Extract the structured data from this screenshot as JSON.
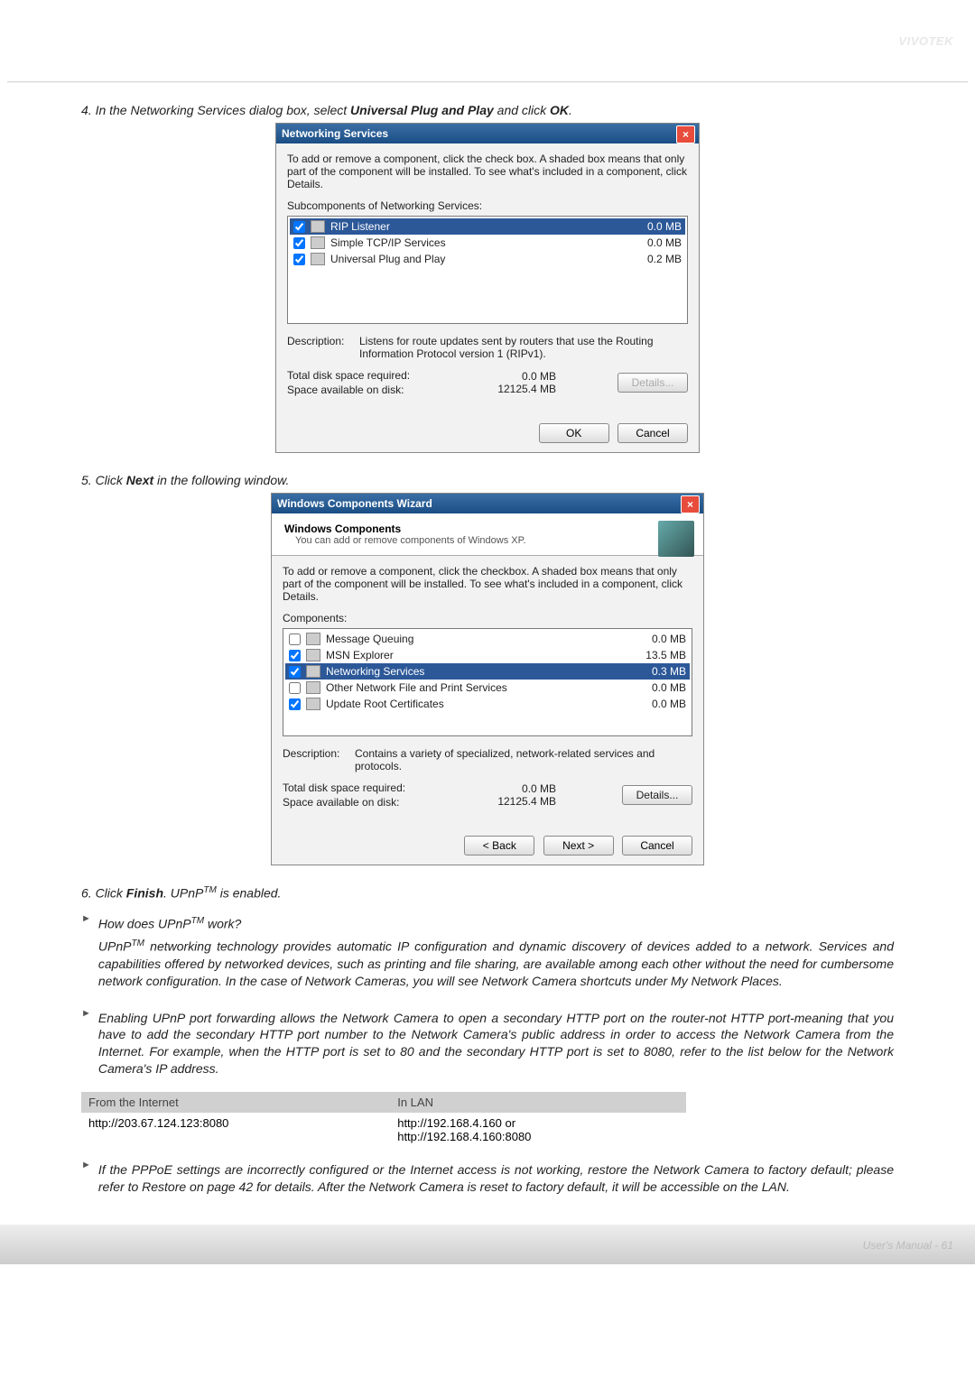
{
  "brand": "VIVOTEK",
  "step4_text_pre": "4. In the Networking Services dialog box, select ",
  "step4_bold1": "Universal Plug and Play",
  "step4_mid": " and click ",
  "step4_bold2": "OK",
  "step4_end": ".",
  "dlg1": {
    "title": "Networking Services",
    "intro": "To add or remove a component, click the check box. A shaded box means that only part of the component will be installed. To see what's included in a component, click Details.",
    "subcap": "Subcomponents of Networking Services:",
    "rows": [
      {
        "name": "RIP Listener",
        "size": "0.0 MB",
        "sel": true
      },
      {
        "name": "Simple TCP/IP Services",
        "size": "0.0 MB",
        "sel": false
      },
      {
        "name": "Universal Plug and Play",
        "size": "0.2 MB",
        "sel": false
      }
    ],
    "desc_lbl": "Description:",
    "desc": "Listens for route updates sent by routers that use the Routing Information Protocol version 1 (RIPv1).",
    "total_lbl": "Total disk space required:",
    "total": "0.0 MB",
    "avail_lbl": "Space available on disk:",
    "avail": "12125.4 MB",
    "details": "Details...",
    "ok": "OK",
    "cancel": "Cancel"
  },
  "step5_pre": "5. Click ",
  "step5_bold": "Next",
  "step5_post": " in the following window.",
  "dlg2": {
    "title": "Windows Components Wizard",
    "h1": "Windows Components",
    "h2": "You can add or remove components of Windows XP.",
    "intro": "To add or remove a component, click the checkbox.  A shaded box means that only part of the component will be installed.  To see what's included in a component, click Details.",
    "compcap": "Components:",
    "rows": [
      {
        "name": "Message Queuing",
        "size": "0.0 MB",
        "sel": false,
        "un": true
      },
      {
        "name": "MSN Explorer",
        "size": "13.5 MB",
        "sel": false
      },
      {
        "name": "Networking Services",
        "size": "0.3 MB",
        "sel": true
      },
      {
        "name": "Other Network File and Print Services",
        "size": "0.0 MB",
        "sel": false,
        "un": true
      },
      {
        "name": "Update Root Certificates",
        "size": "0.0 MB",
        "sel": false
      }
    ],
    "desc_lbl": "Description:",
    "desc": "Contains a variety of specialized, network-related services and protocols.",
    "total_lbl": "Total disk space required:",
    "total": "0.0 MB",
    "avail_lbl": "Space available on disk:",
    "avail": "12125.4 MB",
    "back": "< Back",
    "next": "Next >",
    "cancel": "Cancel",
    "details": "Details..."
  },
  "step6_pre": "6. Click ",
  "step6_bold": "Finish",
  "step6_post": ". UPnP",
  "step6_tm": "TM",
  "step6_end": " is enabled.",
  "q1_pre": "How does UPnP",
  "q1_tm": "TM",
  "q1_post": " work?",
  "p1a": "UPnP",
  "p1b": "TM",
  "p1c": " networking technology provides automatic IP configuration and dynamic discovery of devices added to a network. Services and capabilities offered by networked devices, such as printing and file sharing, are available among each other without the need for cumbersome network configuration. In the case of Network Cameras, you will see Network Camera shortcuts under My Network Places.",
  "p2": "Enabling UPnP port forwarding allows the Network Camera to open a secondary HTTP port on the router-not HTTP port-meaning that you have to add the secondary HTTP port number to the Network Camera's public address in order to access the Network Camera from the Internet. For example, when the HTTP port is set to 80 and the secondary HTTP port is set to 8080, refer to the list below for the Network Camera's IP address.",
  "tbl": {
    "h1": "From the Internet",
    "h2": "In LAN",
    "c1": "http://203.67.124.123:8080",
    "c2": "http://192.168.4.160 or",
    "c3": "http://192.168.4.160:8080"
  },
  "p3": "If the PPPoE settings are incorrectly configured or the Internet access is not working, restore the Network Camera to factory default; please refer to Restore on page 42 for details. After the Network Camera is reset to factory default, it will be accessible on the LAN.",
  "footer": "User's Manual - 61"
}
